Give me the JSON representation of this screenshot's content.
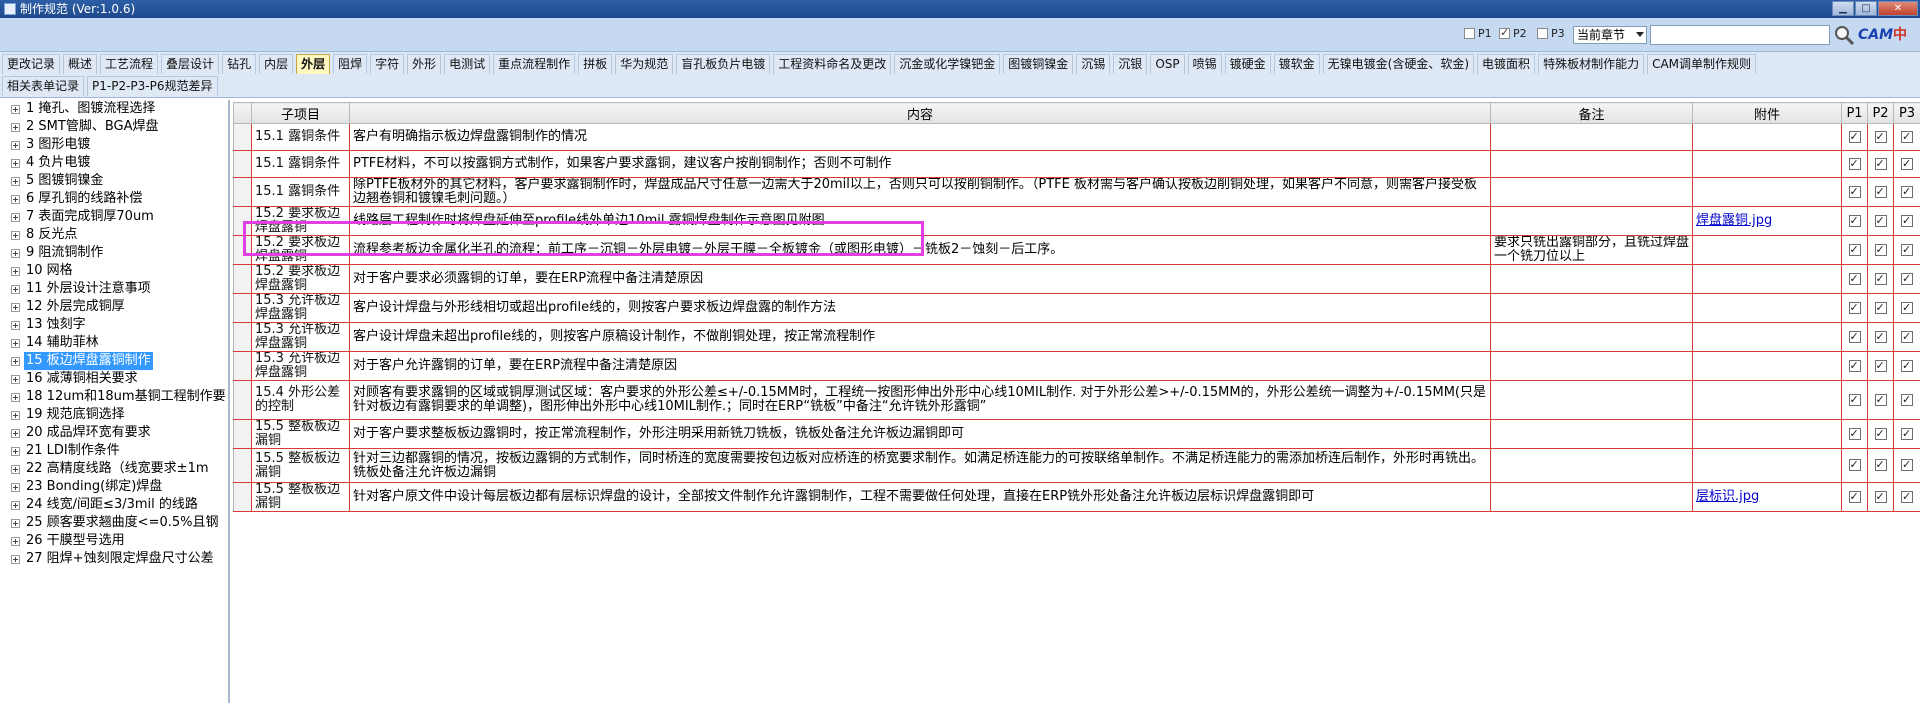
{
  "window": {
    "title": "制作规范 (Ver:1.0.6)",
    "min": "▁",
    "max": "□",
    "close": "✕"
  },
  "controls": {
    "p1_label": "P1",
    "p1_checked": false,
    "p2_label": "P2",
    "p2_checked": true,
    "p3_label": "P3",
    "p3_checked": false,
    "scope_select": "当前章节",
    "search_value": "",
    "brand_en": "CAM",
    "brand_cn": "中心"
  },
  "tabs_row1": [
    {
      "label": "更改记录"
    },
    {
      "label": "概述"
    },
    {
      "label": "工艺流程"
    },
    {
      "label": "叠层设计"
    },
    {
      "label": "钻孔"
    },
    {
      "label": "内层"
    },
    {
      "label": "外层",
      "active": true
    },
    {
      "label": "阻焊"
    },
    {
      "label": "字符"
    },
    {
      "label": "外形"
    },
    {
      "label": "电测试"
    },
    {
      "label": "重点流程制作"
    },
    {
      "label": "拼板"
    },
    {
      "label": "华为规范"
    },
    {
      "label": "盲孔板负片电镀"
    },
    {
      "label": "工程资料命名及更改"
    },
    {
      "label": "沉金或化学镍钯金"
    },
    {
      "label": "图镀铜镍金"
    },
    {
      "label": "沉锡"
    },
    {
      "label": "沉银"
    },
    {
      "label": "OSP"
    },
    {
      "label": "喷锡"
    },
    {
      "label": "镀硬金"
    },
    {
      "label": "镀软金"
    },
    {
      "label": "无镍电镀金(含硬金、软金)"
    },
    {
      "label": "电镀面积"
    },
    {
      "label": "特殊板材制作能力"
    },
    {
      "label": "CAM调单制作规则"
    }
  ],
  "tabs_row2": [
    {
      "label": "相关表单记录"
    },
    {
      "label": "P1-P2-P3-P6规范差异"
    }
  ],
  "tree": [
    {
      "label": "1 掩孔、图镀流程选择"
    },
    {
      "label": "2 SMT管脚、BGA焊盘"
    },
    {
      "label": "3 图形电镀"
    },
    {
      "label": "4 负片电镀"
    },
    {
      "label": "5 图镀铜镍金"
    },
    {
      "label": "6 厚孔铜的线路补偿"
    },
    {
      "label": "7 表面完成铜厚70um"
    },
    {
      "label": "8 反光点"
    },
    {
      "label": "9 阻流铜制作"
    },
    {
      "label": "10 网格"
    },
    {
      "label": "11 外层设计注意事项"
    },
    {
      "label": "12 外层完成铜厚"
    },
    {
      "label": "13 蚀刻字"
    },
    {
      "label": "14 辅助菲林"
    },
    {
      "label": "15 板边焊盘露铜制作",
      "selected": true
    },
    {
      "label": "16 减薄铜相关要求"
    },
    {
      "label": "18 12um和18um基铜工程制作要"
    },
    {
      "label": "19 规范底铜选择"
    },
    {
      "label": "20 成品焊环宽有要求"
    },
    {
      "label": "21 LDI制作条件"
    },
    {
      "label": "22 高精度线路（线宽要求±1m"
    },
    {
      "label": "23 Bonding(绑定)焊盘"
    },
    {
      "label": "24 线宽/间距≤3/3mil 的线路"
    },
    {
      "label": "25 顾客要求翘曲度<=0.5%且钢"
    },
    {
      "label": "26 干膜型号选用"
    },
    {
      "label": "27 阻焊+蚀刻限定焊盘尺寸公差"
    }
  ],
  "grid": {
    "columns": {
      "sub": "子项目",
      "content": "内容",
      "remark": "备注",
      "attach": "附件",
      "p1": "P1",
      "p2": "P2",
      "p3": "P3"
    },
    "rows": [
      {
        "sub": "15.1 露铜条件",
        "content": "客户有明确指示板边焊盘露铜制作的情况",
        "remark": "",
        "attach": ""
      },
      {
        "sub": "15.1 露铜条件",
        "content": "PTFE材料，不可以按露铜方式制作，如果客户要求露铜，建议客户按削铜制作；否则不可制作",
        "remark": "",
        "attach": ""
      },
      {
        "sub": "15.1 露铜条件",
        "content": "除PTFE板材外的其它材料，客户要求露铜制作时，焊盘成品尺寸任意一边需大于20mil以上，否则只可以按削铜制作。（PTFE 板材需与客户确认按板边削铜处理，如果客户不同意，则需客户接受板边翘卷铜和镀镍毛刺问题。）",
        "remark": "",
        "attach": ""
      },
      {
        "sub": "15.2 要求板边焊盘露铜",
        "content": "线路层工程制作时将焊盘延伸至profile线外单边10mil.露铜焊盘制作示意图见附图",
        "remark": "",
        "attach": "焊盘露铜.jpg"
      },
      {
        "sub": "15.2 要求板边焊盘露铜",
        "content": "流程参考板边金属化半孔的流程：前工序－沉铜－外层电镀－外层干膜－全板镀金（或图形电镀）－铣板2－蚀刻－后工序。",
        "remark": "要求只铣出露铜部分，且铣过焊盘一个铣刀位以上",
        "attach": ""
      },
      {
        "sub": "15.2 要求板边焊盘露铜",
        "content": "对于客户要求必须露铜的订单，要在ERP流程中备注清楚原因",
        "remark": "",
        "attach": ""
      },
      {
        "sub": "15.3 允许板边焊盘露铜",
        "content": "客户设计焊盘与外形线相切或超出profile线的，则按客户要求板边焊盘露的制作方法",
        "remark": "",
        "attach": ""
      },
      {
        "sub": "15.3 允许板边焊盘露铜",
        "content": "客户设计焊盘未超出profile线的，则按客户原稿设计制作，不做削铜处理，按正常流程制作",
        "remark": "",
        "attach": ""
      },
      {
        "sub": "15.3 允许板边焊盘露铜",
        "content": "对于客户允许露铜的订单，要在ERP流程中备注清楚原因",
        "remark": "",
        "attach": ""
      },
      {
        "sub": "15.4 外形公差的控制",
        "content": "对顾客有要求露铜的区域或铜厚测试区域：客户要求的外形公差≤+/-0.15MM时，工程统一按图形伸出外形中心线10MIL制作. 对于外形公差>+/-0.15MM的，外形公差统一调整为+/-0.15MM(只是针对板边有露铜要求的单调整)，图形伸出外形中心线10MIL制作.；同时在ERP“铣板”中备注“允许铣外形露铜”",
        "remark": "",
        "attach": ""
      },
      {
        "sub": "15.5 整板板边漏铜",
        "content": "对于客户要求整板板边露铜时，按正常流程制作，外形注明采用新铣刀铣板，铣板处备注允许板边漏铜即可",
        "remark": "",
        "attach": ""
      },
      {
        "sub": "15.5 整板板边漏铜",
        "content": "针对三边都露铜的情况，按板边露铜的方式制作，同时桥连的宽度需要按包边板对应桥连的桥宽要求制作。如满足桥连能力的可按联络单制作。不满足桥连能力的需添加桥连后制作，外形时再铣出。 铣板处备注允许板边漏铜",
        "remark": "",
        "attach": ""
      },
      {
        "sub": "15.5 整板板边漏铜",
        "content": "针对客户原文件中设计每层板边都有层标识焊盘的设计，全部按文件制作允许露铜制作，工程不需要做任何处理，直接在ERP铣外形处备注允许板边层标识焊盘露铜即可",
        "remark": "",
        "attach": "层标识.jpg"
      }
    ]
  }
}
